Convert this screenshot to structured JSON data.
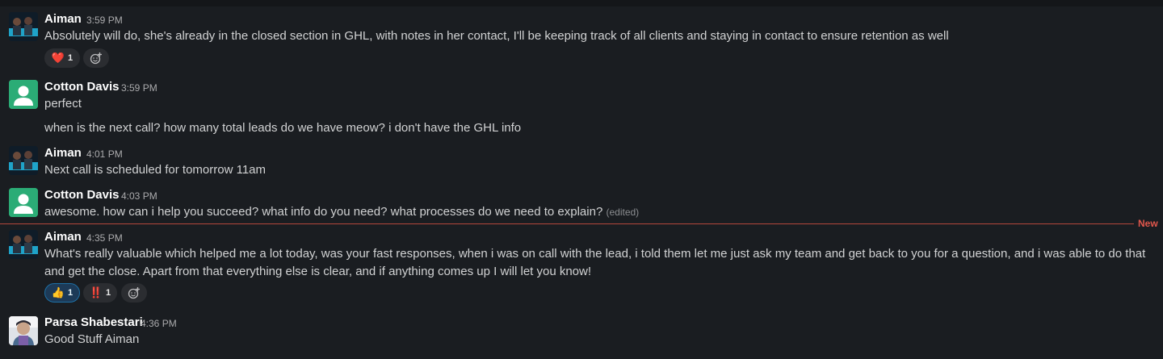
{
  "divider_label": "New",
  "messages": [
    {
      "author": "Aiman",
      "time": "3:59 PM",
      "text": "Absolutely will do, she's already in the closed section in GHL, with notes in her contact, I'll be keeping track of all clients and staying in contact to ensure retention as well",
      "reactions": [
        {
          "emoji": "❤️",
          "count": "1"
        }
      ]
    },
    {
      "author": "Cotton Davis",
      "time": "3:59 PM",
      "text": "perfect",
      "followup": "when is the next call? how many total leads do we have meow? i don't have the GHL info"
    },
    {
      "author": "Aiman",
      "time": "4:01 PM",
      "text": "Next call is scheduled for tomorrow 11am"
    },
    {
      "author": "Cotton Davis",
      "time": "4:03 PM",
      "text": "awesome. how can i help you succeed? what info do you need? what processes do we need to explain?",
      "edited": "(edited)"
    },
    {
      "author": "Aiman",
      "time": "4:35 PM",
      "text": "What's really valuable which helped me a lot today, was your fast responses, when i was on call with the lead, i told them let me just ask my team and get back to you for a question, and i was able to do that and get the close. Apart from that everything else is clear, and if anything comes up I will let you know!",
      "reactions": [
        {
          "emoji": "👍",
          "count": "1"
        },
        {
          "emoji": "‼️",
          "count": "1"
        }
      ]
    },
    {
      "author": "Parsa Shabestari",
      "time": "4:36 PM",
      "text": "Good Stuff Aiman"
    }
  ],
  "colors": {
    "background": "#1a1d21",
    "new_divider": "#b4473b",
    "cotton_avatar": "#2bac76"
  },
  "icons": [
    "add-reaction-icon",
    "person-icon"
  ]
}
